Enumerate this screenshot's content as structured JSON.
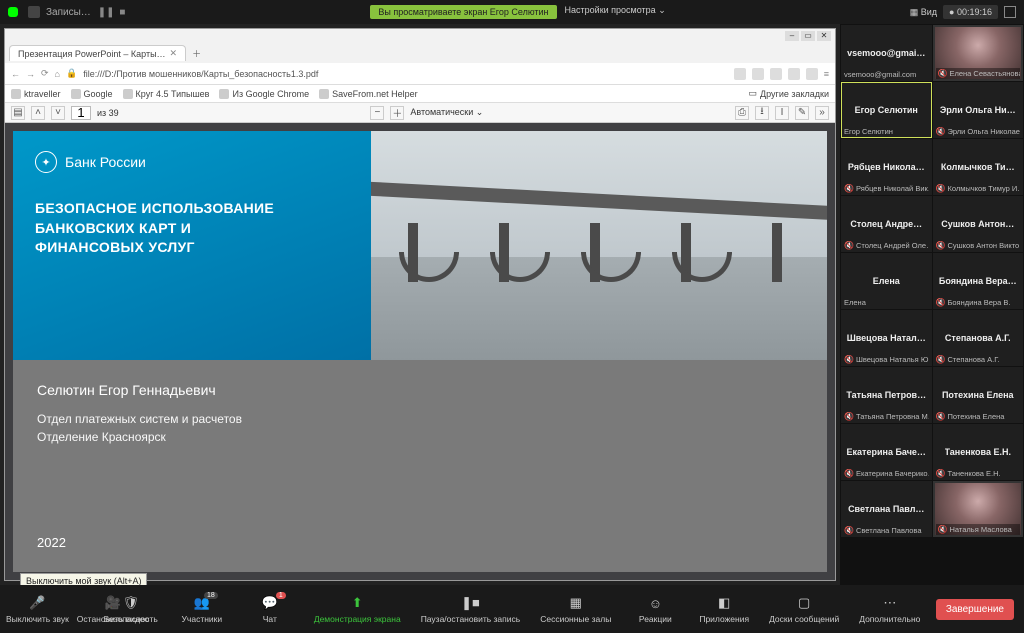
{
  "topbar": {
    "rec_label": "Записы…",
    "banner": "Вы просматриваете экран Егор Селютин",
    "cfg": "Настройки просмотра",
    "view": "Вид",
    "timer": "00:19:16"
  },
  "browser": {
    "tab_title": "Презентация PowerPoint – Карты…",
    "url": "file:///D:/Против мошенников/Карты_безопасность1.3.pdf",
    "bookmarks": [
      "ktraveller",
      "Google",
      "Круг 4.5 Типышев",
      "Из Google Chrome",
      "SaveFrom.net Helper"
    ],
    "other_bm": "Другие закладки"
  },
  "pdf": {
    "page": "1",
    "total_label": "из 39",
    "zoom": "Автоматически"
  },
  "slide": {
    "bank": "Банк России",
    "title_l1": "БЕЗОПАСНОЕ ИСПОЛЬЗОВАНИЕ",
    "title_l2": "БАНКОВСКИХ КАРТ И",
    "title_l3": "ФИНАНСОВЫХ УСЛУГ",
    "speaker": "Селютин Егор Геннадьевич",
    "dept_l1": "Отдел платежных систем и расчетов",
    "dept_l2": "Отделение Красноярск",
    "year": "2022"
  },
  "participants": [
    {
      "name": "vsemooo@gmai…",
      "sub": "vsemooo@gmail.com",
      "muted": false,
      "video": false,
      "host": false
    },
    {
      "name": "",
      "sub": "Елена Севастьянова",
      "muted": true,
      "video": true,
      "host": false
    },
    {
      "name": "Егор Селютин",
      "sub": "Егор Селютин",
      "muted": false,
      "video": false,
      "host": true
    },
    {
      "name": "Эрли Ольга Ни…",
      "sub": "Эрли Ольга Николае…",
      "muted": true,
      "video": false,
      "host": false
    },
    {
      "name": "Рябцев Никола…",
      "sub": "Рябцев Николай Вик…",
      "muted": true,
      "video": false,
      "host": false
    },
    {
      "name": "Колмычков Ти…",
      "sub": "Колмычков Тимур И…",
      "muted": true,
      "video": false,
      "host": false
    },
    {
      "name": "Столец Андре…",
      "sub": "Столец Андрей Оле…",
      "muted": true,
      "video": false,
      "host": false
    },
    {
      "name": "Сушков Антон…",
      "sub": "Сушков Антон Викто…",
      "muted": true,
      "video": false,
      "host": false
    },
    {
      "name": "Елена",
      "sub": "Елена",
      "muted": false,
      "video": false,
      "host": false
    },
    {
      "name": "Бояндина Вера…",
      "sub": "Бояндина Вера В.",
      "muted": true,
      "video": false,
      "host": false
    },
    {
      "name": "Швецова Натал…",
      "sub": "Швецова Наталья Ю…",
      "muted": true,
      "video": false,
      "host": false
    },
    {
      "name": "Степанова А.Г.",
      "sub": "Степанова А.Г.",
      "muted": true,
      "video": false,
      "host": false
    },
    {
      "name": "Татьяна Петров…",
      "sub": "Татьяна Петровна М…",
      "muted": true,
      "video": false,
      "host": false
    },
    {
      "name": "Потехина Елена",
      "sub": "Потехина Елена",
      "muted": true,
      "video": false,
      "host": false
    },
    {
      "name": "Екатерина Баче…",
      "sub": "Екатерина Бачерико…",
      "muted": true,
      "video": false,
      "host": false
    },
    {
      "name": "Таненкова Е.Н.",
      "sub": "Таненкова Е.Н.",
      "muted": true,
      "video": false,
      "host": false
    },
    {
      "name": "Светлана Павл…",
      "sub": "Светлана Павлова",
      "muted": true,
      "video": false,
      "host": false
    },
    {
      "name": "",
      "sub": "Наталья Маслова",
      "muted": true,
      "video": true,
      "host": false
    }
  ],
  "toolbar": {
    "mute": "Выключить звук",
    "stop_video": "Остановить видео",
    "security": "Безопасность",
    "participants": "Участники",
    "p_count": "18",
    "chat": "Чат",
    "chat_badge": "1",
    "share": "Демонстрация экрана",
    "pause_rec": "Пауза/остановить запись",
    "rooms": "Сессионные залы",
    "react": "Реакции",
    "apps": "Приложения",
    "boards": "Доски сообщений",
    "more": "Дополнительно",
    "end": "Завершение",
    "tooltip": "Выключить мой звук (Alt+A)"
  }
}
